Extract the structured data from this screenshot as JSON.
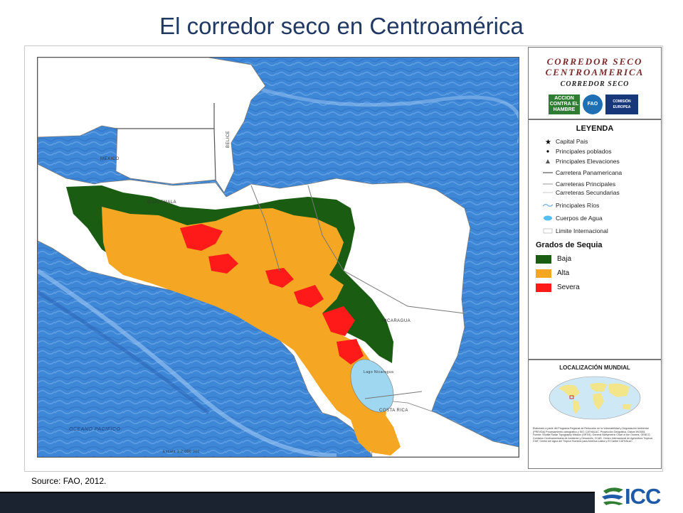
{
  "slide": {
    "title": "El corredor seco en Centroamérica",
    "source": "Source: FAO, 2012."
  },
  "map": {
    "labels": {
      "mexico": "MEXICO",
      "belice": "BELICE",
      "guatemala": "GUATEMALA",
      "nicaragua": "NICARAGUA",
      "costa_rica": "COSTA RICA",
      "oceano": "OCEANO PACIFICO",
      "lago_nicaragua": "Lago Nicaragua",
      "scale": "Escala 1:2.000.000"
    },
    "colors": {
      "ocean": "#3e86d6",
      "land": "#ffffff",
      "baja": "#1a5c12",
      "alta": "#f5a623",
      "severa": "#ff1a1a",
      "lake": "#9fd6f0"
    }
  },
  "legend": {
    "header_line1": "CORREDOR SECO",
    "header_line2": "CENTROAMERICA",
    "subtitle": "CORREDOR SECO",
    "logos": [
      "ACCION CONTRA EL HAMBRE",
      "FAO",
      "COMISIÓN EUROPEA"
    ],
    "title": "LEYENDA",
    "items": [
      {
        "label": "Capital Pais",
        "icon": "star-icon"
      },
      {
        "label": "Principales poblados",
        "icon": "dot-icon"
      },
      {
        "label": "Principales Elevaciones",
        "icon": "triangle-icon"
      },
      {
        "label": "Carretera Panamericana",
        "icon": "line-icon"
      },
      {
        "label": "Carreteras Principales",
        "icon": "line-icon"
      },
      {
        "label": "Carreteras Secundarias",
        "icon": "line-icon"
      },
      {
        "label": "Principales Ríos",
        "icon": "river-icon"
      },
      {
        "label": "Cuerpos de Agua",
        "icon": "water-icon"
      },
      {
        "label": "Limite Internacional",
        "icon": "border-icon"
      }
    ],
    "drought_title": "Grados de Sequia",
    "drought": [
      {
        "label": "Baja",
        "color": "#1a5c12"
      },
      {
        "label": "Alta",
        "color": "#f5a623"
      },
      {
        "label": "Severa",
        "color": "#ff1a1a"
      }
    ],
    "location_title": "LOCALIZACIÓN MUNDIAL",
    "credits": "Elaborado a partir del Programa Regional de Reducción de la Vulnerabilidad y Degradación Ambiental (PREVDA) Procesamiento cartográfico y SIG: CATHALAC. Proyección Geográfica, Datum WGS84. Fuente: Shuttle Radar Topography Mission (SRTM), General Bathymetric Chart of the Oceans, GEBCO, Comisión Centroamericana de Ambiente y Desarrollo, CCAD, Centro Internacional de Agricultura Tropical, CIAT, Centro del Agua del Trópico Húmedo para América Latina y El Caribe CATHALAC."
  },
  "footer": {
    "logo_text": "ICC"
  }
}
